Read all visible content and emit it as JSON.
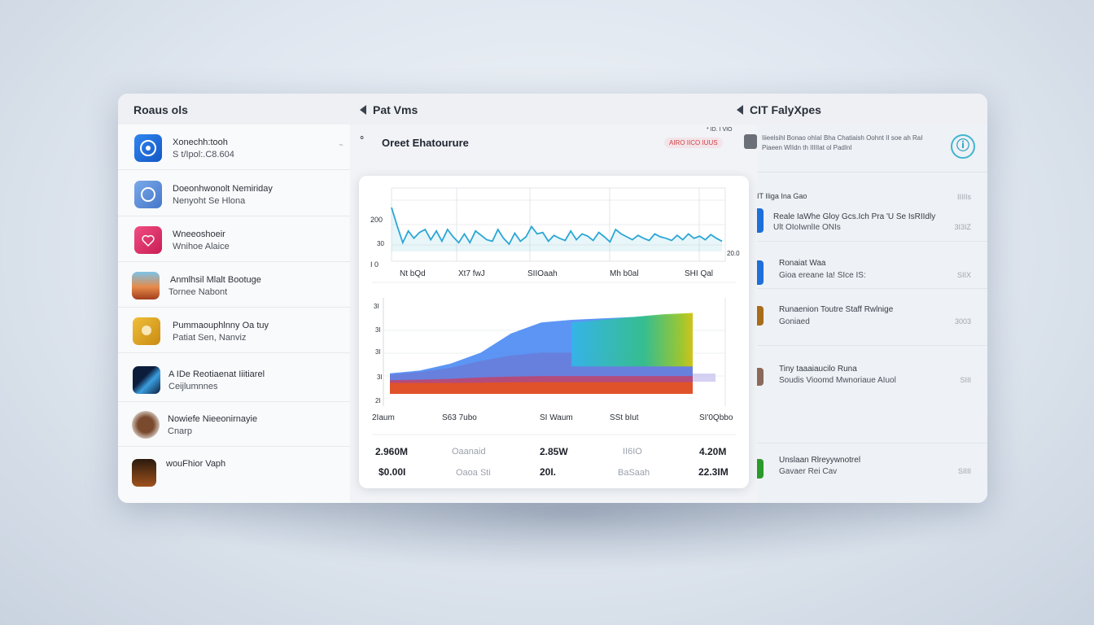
{
  "window": {
    "left_title": "Roaus ols",
    "center_title": "Pat Vms",
    "right_title": "CIT FalyXpes"
  },
  "list": {
    "items": [
      {
        "line1": "Xonechh:tooh",
        "line2": "S t/Ipol:.C8.604",
        "icon": "gear-icon",
        "color": "#1e6fd9"
      },
      {
        "line1": "Doeonhwonolt Nemiriday",
        "line2": "Nenyoht Se Hlona",
        "icon": "camera-icon",
        "color": "#5b8fd8"
      },
      {
        "line1": "Wneeoshoeir",
        "line2": "Wnihoe Alaice",
        "icon": "heart-icon",
        "color": "#e0336b"
      },
      {
        "line1": "Anmlhsil Mlalt Bootuge",
        "line2": "Tornee Nabont",
        "icon": "landscape-icon",
        "color": "#d66a3a"
      },
      {
        "line1": "Pummaouphlnny Oa tuy",
        "line2": "Patiat Sen, Nanviz",
        "icon": "pin-icon",
        "color": "#d9a021"
      },
      {
        "line1": "A IDe Reotiaenat Iiitiarel",
        "line2": "Ceijlumnnes",
        "icon": "photo-icon",
        "color": "#123a7a"
      },
      {
        "line1": "Nowiefe Nieeonirnayie",
        "line2": "Cnarp",
        "icon": "food-icon",
        "color": "#7a4a2e"
      },
      {
        "line1": "wouFhior Vaph",
        "line2": "",
        "icon": "box-icon",
        "color": "#5a3a20"
      }
    ]
  },
  "center": {
    "title": "Oreet Ehatourure",
    "badge": "AIRO IICO IUUS",
    "tiny_label": "* ID. I VIO",
    "card": {
      "stats_row1": [
        "2.960M",
        "Oaanaid",
        "2.85W",
        "II6IO",
        "4.20M"
      ],
      "stats_row2": [
        "$0.00I",
        "Oaoa Sti",
        "20I.",
        "BaSaah",
        "22.3IM"
      ]
    }
  },
  "chart_data": [
    {
      "type": "line",
      "x_tick_labels": [
        "Nt bQd",
        "Xt7 fwJ",
        "SIIOaah",
        "Mh b0al",
        "SHI Qal"
      ],
      "y_tick_labels": [
        "200",
        "30",
        "I 0"
      ],
      "end_label": "20.0",
      "series": [
        {
          "values": [
            60,
            35,
            12,
            28,
            18,
            26,
            30,
            16,
            28,
            14,
            30,
            20,
            12,
            24,
            12,
            28,
            22,
            16,
            14,
            30,
            18,
            10,
            25,
            14,
            20,
            34,
            24,
            26,
            14,
            22,
            18,
            15,
            28,
            16,
            24,
            21,
            15,
            26,
            20,
            13,
            30,
            24,
            20,
            16,
            22,
            18,
            15,
            24,
            20,
            18,
            15,
            22,
            16,
            24,
            18,
            21,
            16,
            23,
            18,
            14
          ]
        }
      ],
      "ylim": [
        0,
        100
      ],
      "grid": true
    },
    {
      "type": "area",
      "x_tick_labels": [
        "2Iaum",
        "S63 7ubo",
        "SI Waum",
        "SSt bIut",
        "SI'0Qbbo"
      ],
      "y_tick_labels": [
        "3I",
        "3I",
        "3I",
        "3I",
        "2I"
      ],
      "x": [
        0,
        1,
        2,
        3,
        4,
        5,
        6,
        7,
        8,
        9,
        10
      ],
      "series": [
        {
          "name": "",
          "color": "#e8541a",
          "values": [
            8,
            8,
            8,
            8.2,
            8.4,
            8.6,
            8.6,
            8.6,
            8.6,
            8.6,
            8.6
          ]
        },
        {
          "name": "",
          "color": "#c0436c",
          "values": [
            10,
            10.4,
            11,
            12,
            12.6,
            13,
            13,
            13,
            13,
            13,
            13
          ]
        },
        {
          "name": "",
          "color": "#6a7dd8",
          "values": [
            14,
            16,
            19,
            24,
            28,
            30,
            30,
            30,
            30,
            30,
            30
          ]
        },
        {
          "name": "",
          "color": "#3f82f2",
          "values": [
            15,
            17,
            22,
            30,
            44,
            52,
            54,
            55,
            56,
            57,
            58
          ]
        },
        {
          "name": "",
          "color": "#33c0b0",
          "values": [
            0,
            0,
            0,
            0,
            0,
            0,
            52,
            54,
            56,
            58,
            59
          ]
        },
        {
          "name": "",
          "color": "#c7d219",
          "values": [
            0,
            0,
            0,
            0,
            0,
            0,
            0,
            0,
            0,
            0,
            60
          ]
        }
      ],
      "ylim": [
        0,
        70
      ],
      "grid": true
    }
  ],
  "right": {
    "top_text": "Iiieelsihl Bonao ohIaI Bha Chatiaish Oohnt II soe ah RaI Piaeen WIIdn th IIIIIat ol PadInl",
    "rows": [
      {
        "t1": "IT Iliga Ina Gao",
        "t2": "",
        "val": "IIIIIs",
        "color": ""
      },
      {
        "t1": "Reale IaWhe Gloy Gcs.Ich Pra 'U Se IsRIIdly",
        "t2": "Ult OIoIwnlIe ONIs",
        "val": "3I3IZ",
        "color": "#1e6fd9"
      },
      {
        "t1": "Ronaiat Waa",
        "t2": "Gioa ereane Ia! SIce IS:",
        "val": "SIIX",
        "color": "#1e6fd9"
      },
      {
        "t1": "Runaenion Toutre Staff Rwlnige",
        "t2": "Goniaed",
        "val": "3003",
        "color": "#a86d1a"
      },
      {
        "t1": "Tiny taaaiaucilo Runa",
        "t2": "Soudis Vioomd Mwnoriaue AIuol",
        "val": "SIII",
        "color": "#8a6a5a"
      },
      {
        "t1": "Unslaan Rlreyywnotrel",
        "t2": "Gavaer Rei Cav",
        "val": "SIIII",
        "color": "#2a9a2a"
      }
    ]
  }
}
